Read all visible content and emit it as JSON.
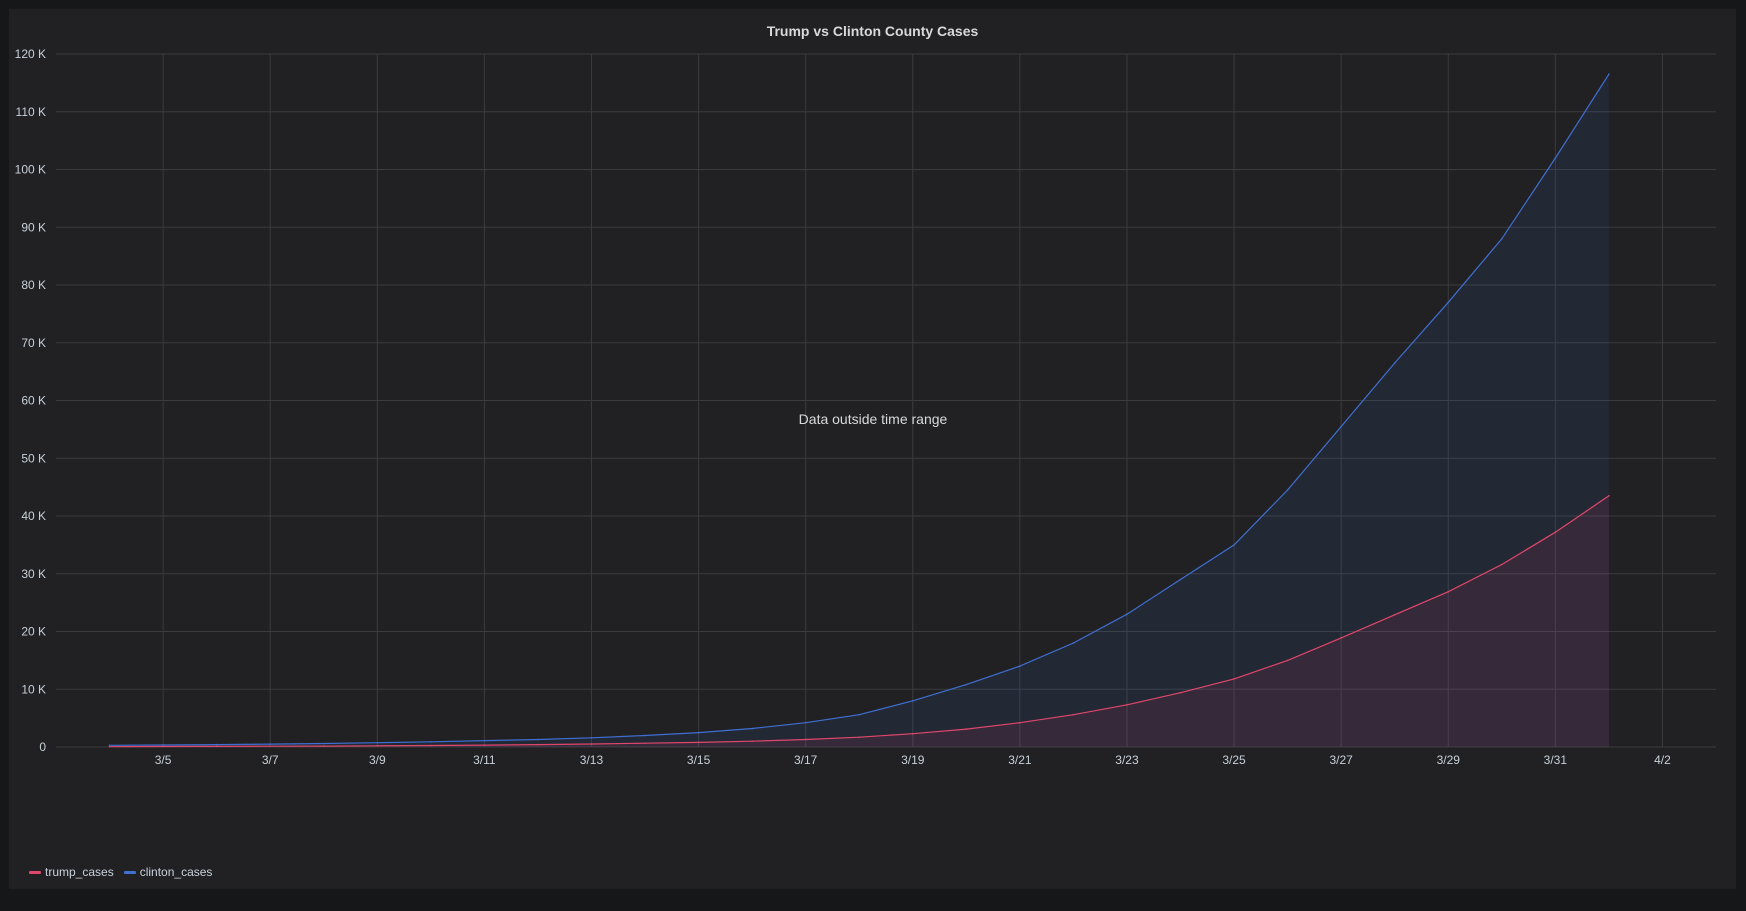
{
  "panel": {
    "title": "Trump vs Clinton County Cases",
    "overlay_message": "Data outside time range"
  },
  "colors": {
    "background": "#161719",
    "panel": "#212124",
    "grid": "#3a3b3e",
    "text": "#c7d0d9",
    "trump": "#e0476a",
    "clinton": "#3f6fd1"
  },
  "chart_data": {
    "type": "area",
    "title": "Trump vs Clinton County Cases",
    "xlabel": "",
    "ylabel": "",
    "x_tick_labels": [
      "3/5",
      "3/7",
      "3/9",
      "3/11",
      "3/13",
      "3/15",
      "3/17",
      "3/19",
      "3/21",
      "3/23",
      "3/25",
      "3/27",
      "3/29",
      "3/31",
      "4/2"
    ],
    "y_tick_labels": [
      "0",
      "10 K",
      "20 K",
      "30 K",
      "40 K",
      "50 K",
      "60 K",
      "70 K",
      "80 K",
      "90 K",
      "100 K",
      "110 K",
      "120 K"
    ],
    "xlim": [
      "2020-03-03",
      "2020-04-03"
    ],
    "ylim": [
      0,
      120000
    ],
    "grid": true,
    "legend": "bottom-left",
    "x": [
      "2020-03-04",
      "2020-03-05",
      "2020-03-06",
      "2020-03-07",
      "2020-03-08",
      "2020-03-09",
      "2020-03-10",
      "2020-03-11",
      "2020-03-12",
      "2020-03-13",
      "2020-03-14",
      "2020-03-15",
      "2020-03-16",
      "2020-03-17",
      "2020-03-18",
      "2020-03-19",
      "2020-03-20",
      "2020-03-21",
      "2020-03-22",
      "2020-03-23",
      "2020-03-24",
      "2020-03-25",
      "2020-03-26",
      "2020-03-27",
      "2020-03-28",
      "2020-03-29",
      "2020-03-30",
      "2020-03-31",
      "2020-04-01"
    ],
    "series": [
      {
        "name": "trump_cases",
        "color": "#e0476a",
        "values": [
          60,
          80,
          100,
          130,
          160,
          200,
          260,
          330,
          420,
          520,
          650,
          800,
          1000,
          1300,
          1700,
          2300,
          3100,
          4200,
          5600,
          7300,
          9400,
          11800,
          15000,
          18900,
          22900,
          26900,
          31600,
          37200,
          43500
        ]
      },
      {
        "name": "clinton_cases",
        "color": "#3f6fd1",
        "values": [
          300,
          350,
          420,
          500,
          600,
          750,
          900,
          1100,
          1300,
          1600,
          2000,
          2500,
          3200,
          4200,
          5600,
          8000,
          10800,
          14000,
          18000,
          23000,
          29000,
          35000,
          44500,
          55500,
          66500,
          77000,
          88000,
          102000,
          116500
        ]
      }
    ]
  }
}
